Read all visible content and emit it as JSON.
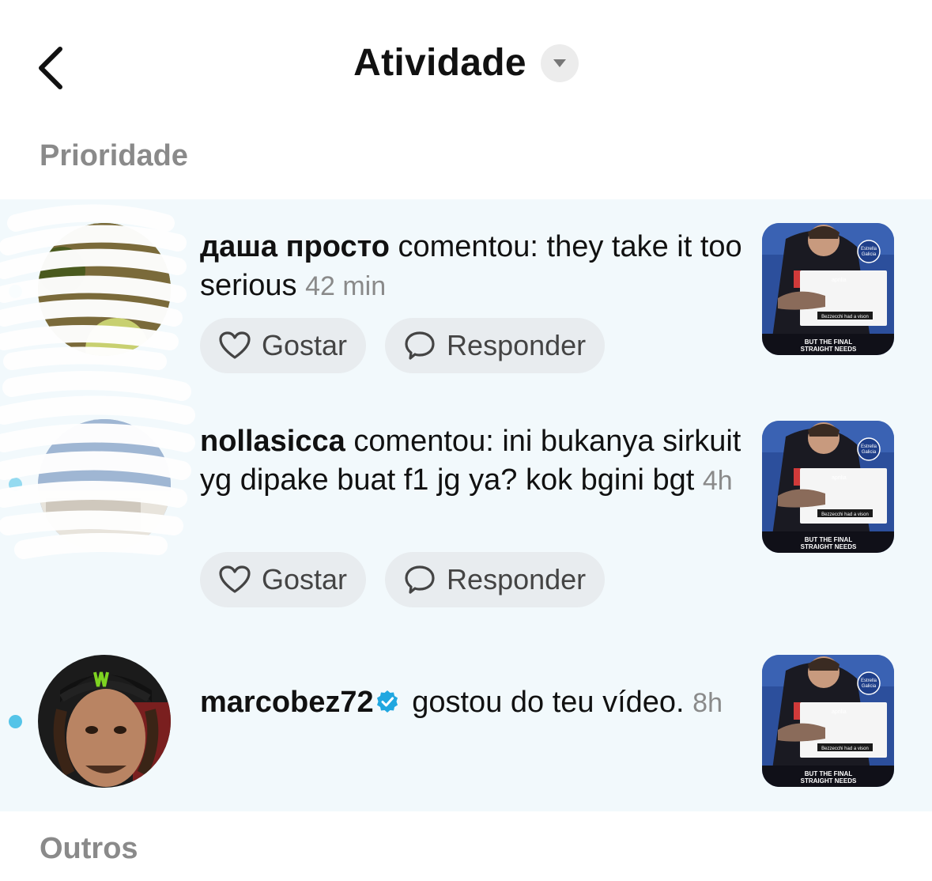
{
  "header": {
    "title": "Atividade",
    "back_icon": "chevron-left-icon",
    "dropdown_icon": "caret-down-icon"
  },
  "sections": {
    "priority": "Prioridade",
    "others": "Outros"
  },
  "actions": {
    "like_label": "Gostar",
    "reply_label": "Responder"
  },
  "thumbnail": {
    "brand_line1": "Estrella",
    "brand_line2": "Galicia",
    "sponsor": "aprilia",
    "board_text": "Bezzecchi had a vison",
    "caption_line1": "BUT THE FINAL",
    "caption_line2": "STRAIGHT NEEDS"
  },
  "notifications": [
    {
      "username": "даша просто",
      "text": " comentou: they take it too serious ",
      "time": "42 min",
      "unread": true
    },
    {
      "username": "nollasicca",
      "text": " comentou: ini bukanya sirkuit yg dipake buat f1 jg ya? kok bgini bgt ",
      "time": "4h",
      "unread": true
    },
    {
      "username": "marcobez72",
      "verified": true,
      "text": " gostou do teu vídeo. ",
      "time": "8h",
      "unread": true
    }
  ],
  "colors": {
    "priority_bg": "#f2f9fc",
    "unread_dot": "#55c4e8",
    "pill_bg": "#e8ecef",
    "muted_text": "#8a8a8a",
    "verified": "#20a7e0"
  }
}
